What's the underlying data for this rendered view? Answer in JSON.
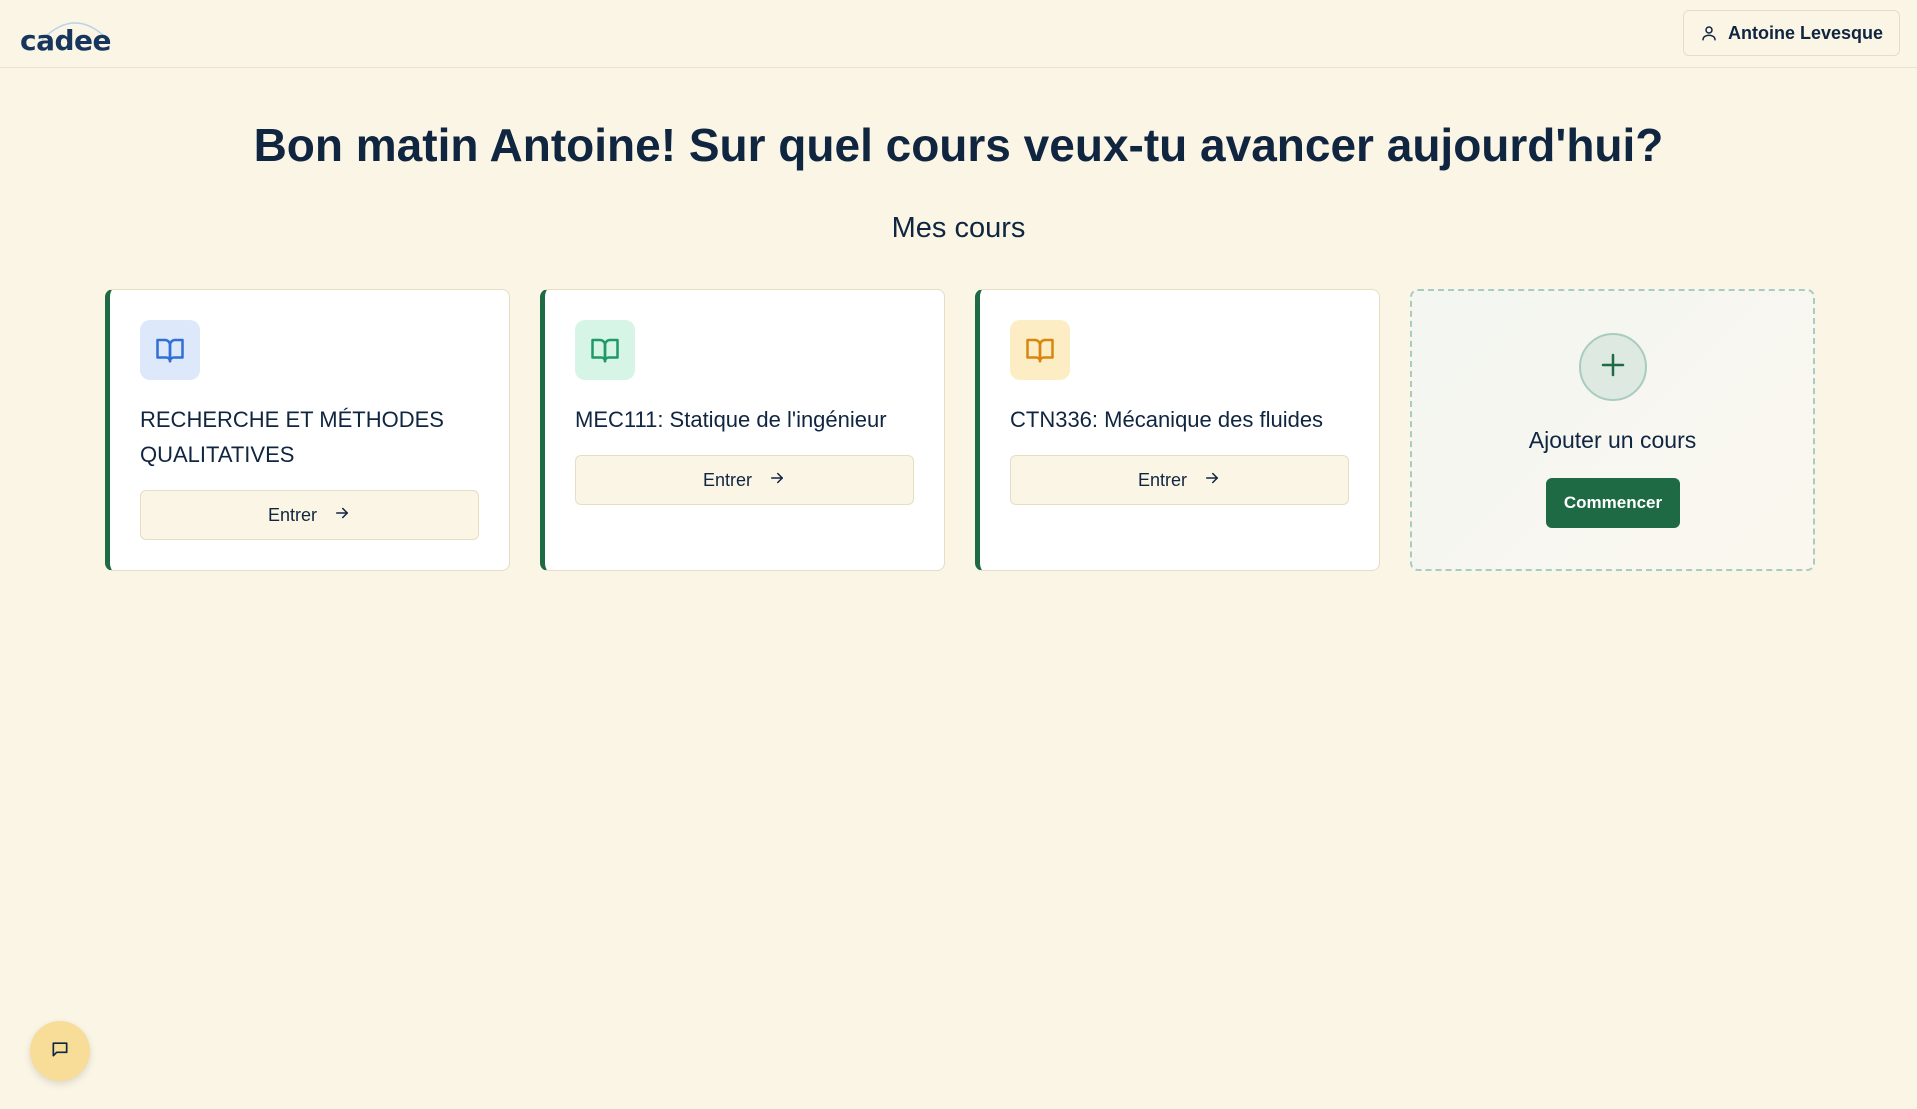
{
  "app": {
    "logo_text": "cadee"
  },
  "header": {
    "user_name": "Antoine Levesque"
  },
  "main": {
    "greeting": "Bon matin Antoine! Sur quel cours veux-tu avancer aujourd'hui?",
    "section_title": "Mes cours",
    "courses": [
      {
        "title": "RECHERCHE ET MÉTHODES QUALITATIVES",
        "button_label": "Entrer",
        "icon": "book-icon",
        "icon_color": "#2f6fd6",
        "icon_bg": "#dde8fb"
      },
      {
        "title": "MEC111: Statique de l'ingénieur",
        "button_label": "Entrer",
        "icon": "book-icon",
        "icon_color": "#1f9a66",
        "icon_bg": "#d6f5e6"
      },
      {
        "title": "CTN336: Mécanique des fluides",
        "button_label": "Entrer",
        "icon": "book-icon",
        "icon_color": "#d9860f",
        "icon_bg": "#fcedc4"
      }
    ],
    "add_course": {
      "label": "Ajouter un cours",
      "button_label": "Commencer",
      "icon": "plus-icon"
    }
  },
  "colors": {
    "background": "#fbf5e5",
    "accent": "#1e6a44",
    "text": "#0f2540",
    "chat_fab": "#f7dd98"
  },
  "chat": {
    "icon": "chat-bubble-icon"
  }
}
